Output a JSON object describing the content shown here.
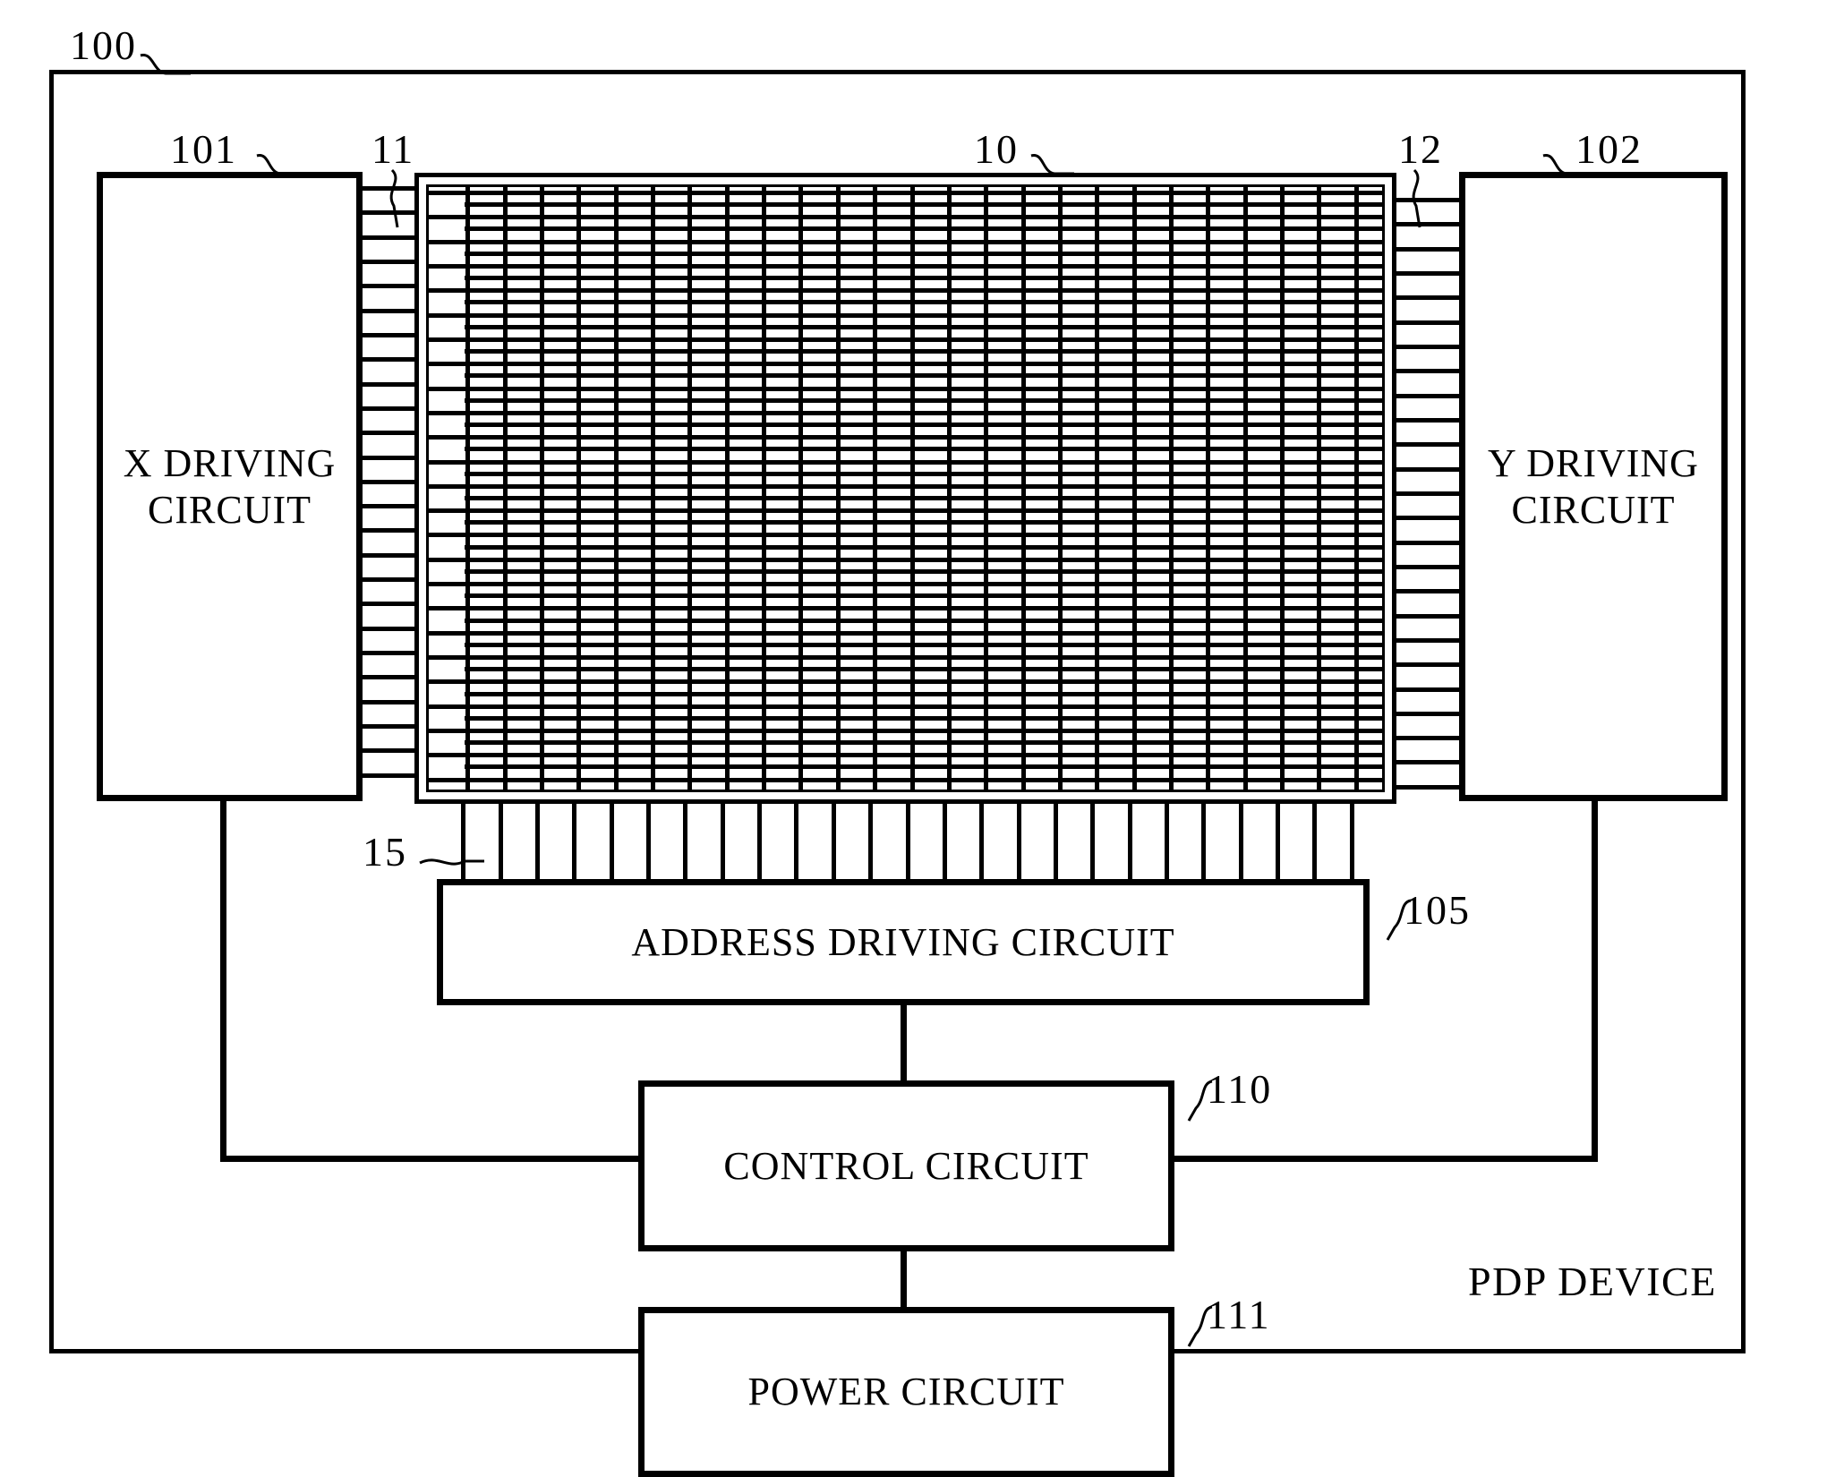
{
  "figure": {
    "device_label": "PDP DEVICE",
    "blocks": {
      "x_driving": "X DRIVING\nCIRCUIT",
      "x_driving_line1": "X DRIVING",
      "x_driving_line2": "CIRCUIT",
      "y_driving_line1": "Y DRIVING",
      "y_driving_line2": "CIRCUIT",
      "address_driving": "ADDRESS DRIVING CIRCUIT",
      "control": "CONTROL CIRCUIT",
      "power": "POWER CIRCUIT"
    },
    "reference_numerals": [
      {
        "id": "ref-100",
        "text": "100",
        "target": "pdp-device-frame"
      },
      {
        "id": "ref-101",
        "text": "101",
        "target": "x-driving-circuit"
      },
      {
        "id": "ref-11",
        "text": "11",
        "target": "x-electrodes"
      },
      {
        "id": "ref-10",
        "text": "10",
        "target": "plasma-display-panel"
      },
      {
        "id": "ref-12",
        "text": "12",
        "target": "y-electrodes"
      },
      {
        "id": "ref-102",
        "text": "102",
        "target": "y-driving-circuit"
      },
      {
        "id": "ref-15",
        "text": "15",
        "target": "address-electrodes"
      },
      {
        "id": "ref-105",
        "text": "105",
        "target": "address-driving-circuit"
      },
      {
        "id": "ref-110",
        "text": "110",
        "target": "control-circuit"
      },
      {
        "id": "ref-111",
        "text": "111",
        "target": "power-circuit"
      }
    ],
    "colors": {
      "ink": "#000000",
      "paper": "#ffffff"
    }
  }
}
